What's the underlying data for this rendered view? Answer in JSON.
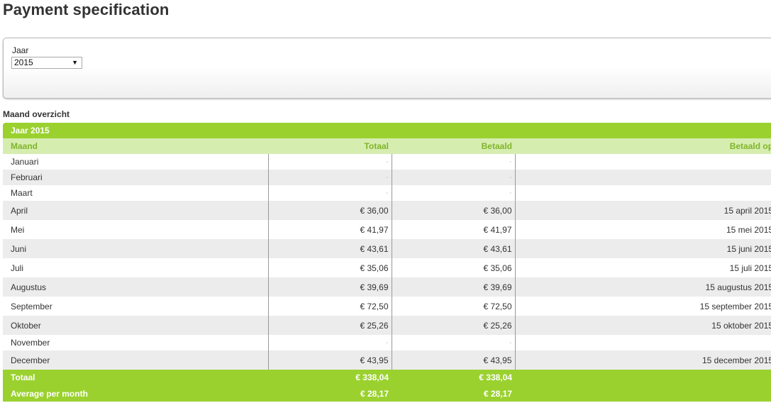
{
  "page": {
    "title": "Payment specification"
  },
  "filter": {
    "year_label": "Jaar",
    "year_value": "2015"
  },
  "overview": {
    "section_title": "Maand overzicht",
    "year_header": "Jaar 2015",
    "columns": [
      "Maand",
      "Totaal",
      "Betaald",
      "Betaald op"
    ],
    "rows": [
      {
        "month": "Januari",
        "total": "-",
        "paid": "-",
        "paid_on": "-"
      },
      {
        "month": "Februari",
        "total": "-",
        "paid": "-",
        "paid_on": "-"
      },
      {
        "month": "Maart",
        "total": "-",
        "paid": "-",
        "paid_on": "-"
      },
      {
        "month": "April",
        "total": "€ 36,00",
        "paid": "€ 36,00",
        "paid_on": "15 april 2015"
      },
      {
        "month": "Mei",
        "total": "€ 41,97",
        "paid": "€ 41,97",
        "paid_on": "15 mei 2015"
      },
      {
        "month": "Juni",
        "total": "€ 43,61",
        "paid": "€ 43,61",
        "paid_on": "15 juni 2015"
      },
      {
        "month": "Juli",
        "total": "€ 35,06",
        "paid": "€ 35,06",
        "paid_on": "15 juli 2015"
      },
      {
        "month": "Augustus",
        "total": "€ 39,69",
        "paid": "€ 39,69",
        "paid_on": "15 augustus 2015"
      },
      {
        "month": "September",
        "total": "€ 72,50",
        "paid": "€ 72,50",
        "paid_on": "15 september 2015"
      },
      {
        "month": "Oktober",
        "total": "€ 25,26",
        "paid": "€ 25,26",
        "paid_on": "15 oktober 2015"
      },
      {
        "month": "November",
        "total": "-",
        "paid": "-",
        "paid_on": "-"
      },
      {
        "month": "December",
        "total": "€ 43,95",
        "paid": "€ 43,95",
        "paid_on": "15 december 2015"
      }
    ],
    "totals": {
      "label": "Totaal",
      "total": "€ 338,04",
      "paid": "€ 338,04",
      "avg_label": "Average per month",
      "avg_total": "€ 28,17",
      "avg_paid": "€ 28,17"
    }
  },
  "colors": {
    "accent_green": "#9ad12f",
    "header_light_green": "#d6edb0",
    "header_text_green": "#7fb52a",
    "row_alt_gray": "#ececec"
  },
  "icons": {
    "select_arrow": "dropdown-arrow-icon"
  }
}
